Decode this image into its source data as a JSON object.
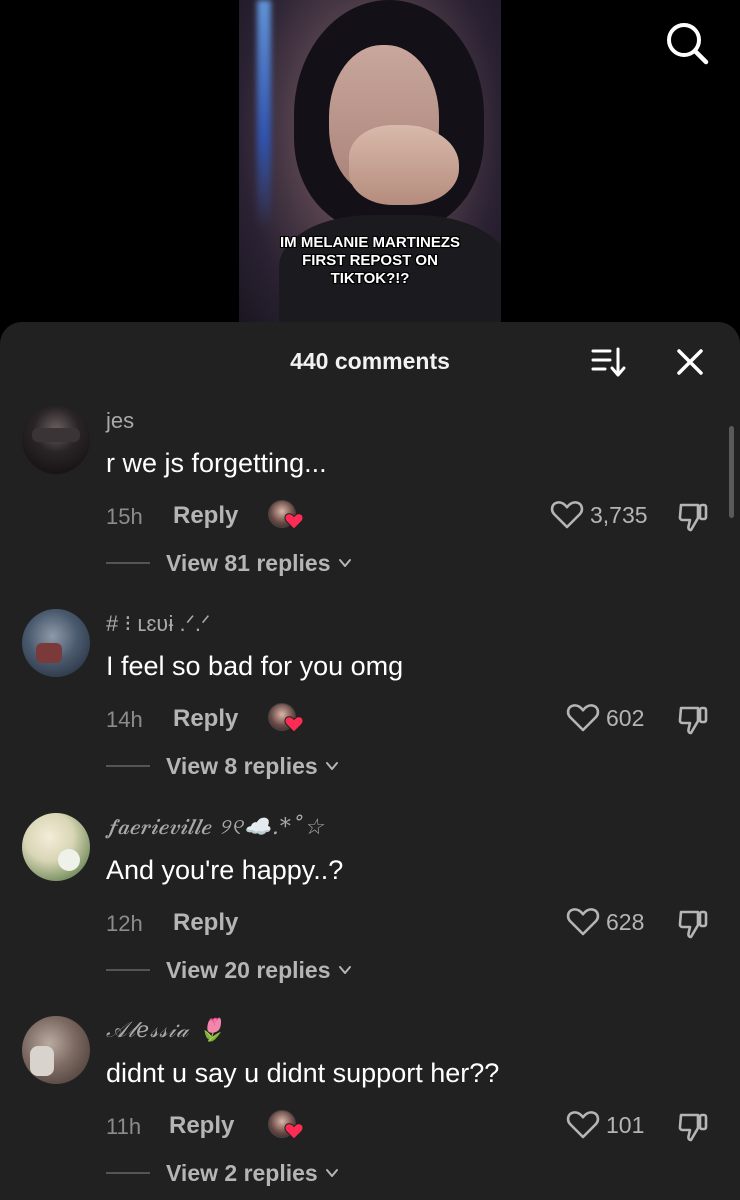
{
  "video": {
    "caption": "IM MELANIE MARTINEZS\nFIRST REPOST ON\nTIKTOK?!?"
  },
  "icons": {
    "search": "search-icon",
    "sort": "sort-icon",
    "close": "close-icon",
    "like": "heart-outline-icon",
    "dislike": "thumbs-down-icon",
    "creator_liked": "heart-badge-icon",
    "chevron": "chevron-down-icon"
  },
  "colors": {
    "sheet_bg": "#212121",
    "heart_badge": "#fe2c55",
    "muted_text": "#b5b5b5"
  },
  "comments_sheet": {
    "title": "440 comments"
  },
  "comments": [
    {
      "username": "jes",
      "text": "r we js forgetting...",
      "time": "15h",
      "reply_label": "Reply",
      "likes": "3,735",
      "view_replies": "View 81 replies"
    },
    {
      "username": "# ⁝ ʟɛʋɨ .ᐟ.ᐟ",
      "text": "I feel so bad for you omg",
      "time": "14h",
      "reply_label": "Reply",
      "likes": "602",
      "view_replies": "View 8 replies"
    },
    {
      "username": "𝒇𝒂𝒆𝒓𝒊𝒆𝒗𝒊𝒍𝒍𝒆 ୨୧☁️.*˚☆",
      "text": "And you're happy..?",
      "time": "12h",
      "reply_label": "Reply",
      "likes": "628",
      "view_replies": "View 20 replies"
    },
    {
      "username": "𝒜𝓁𝑒𝓈𝓈𝒾𝒶 🌷",
      "text": "didnt u say u didnt support her??",
      "time": "11h",
      "reply_label": "Reply",
      "likes": "101",
      "view_replies": "View 2 replies"
    }
  ]
}
